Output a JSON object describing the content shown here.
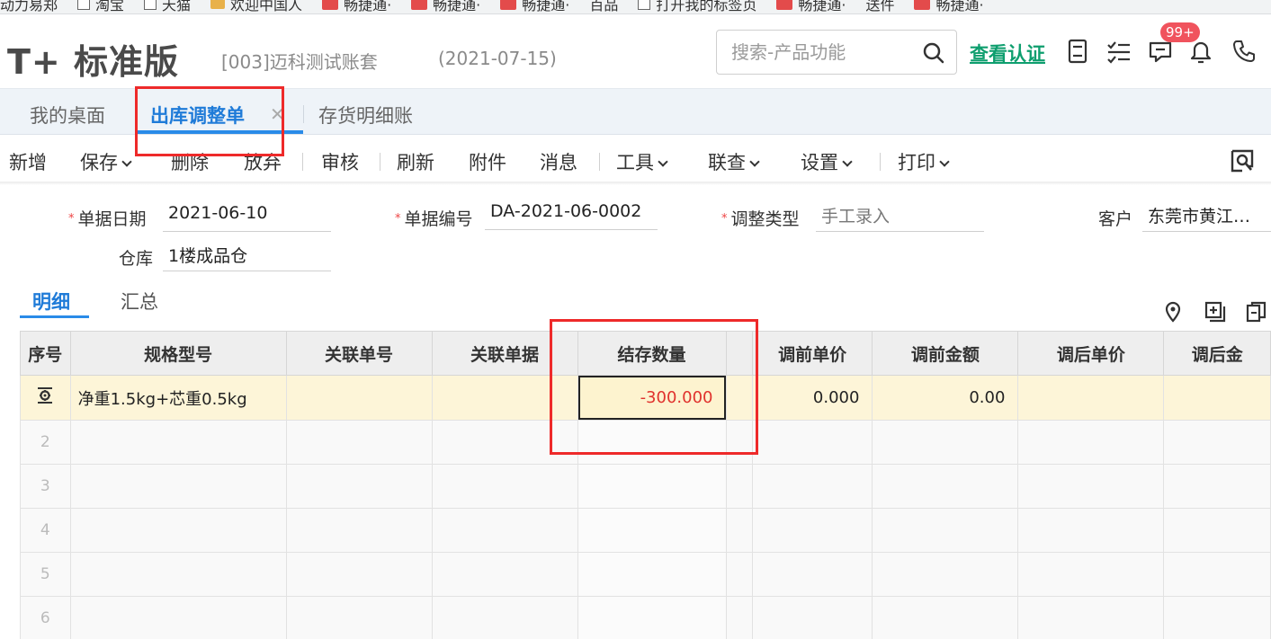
{
  "bookmarks": [
    {
      "label": "动力易郑",
      "kind": "text"
    },
    {
      "label": "淘宝",
      "kind": "square"
    },
    {
      "label": "天猫",
      "kind": "square"
    },
    {
      "label": "欢迎中国人",
      "kind": "folder"
    },
    {
      "label": "畅捷通·",
      "kind": "red"
    },
    {
      "label": "畅捷通·",
      "kind": "red"
    },
    {
      "label": "畅捷通·",
      "kind": "red"
    },
    {
      "label": "百品",
      "kind": "text"
    },
    {
      "label": "打开我的标签页",
      "kind": "square"
    },
    {
      "label": "畅捷通·",
      "kind": "red"
    },
    {
      "label": "送件",
      "kind": "text"
    },
    {
      "label": "畅捷通·",
      "kind": "red"
    }
  ],
  "header": {
    "logo": "T+ 标准版",
    "account": "[003]迈科测试账套",
    "date": "(2021-07-15)",
    "search_placeholder": "搜索-产品功能",
    "verify_link": "查看认证",
    "badge": "99+"
  },
  "tabs": [
    {
      "label": "我的桌面",
      "active": false
    },
    {
      "label": "出库调整单",
      "active": true
    },
    {
      "label": "存货明细账",
      "active": false
    }
  ],
  "toolbar": {
    "add": "新增",
    "save": "保存",
    "delete": "删除",
    "discard": "放弃",
    "audit": "审核",
    "refresh": "刷新",
    "attach": "附件",
    "message": "消息",
    "tools": "工具",
    "linked_query": "联查",
    "settings": "设置",
    "print": "打印"
  },
  "form": {
    "date_label": "单据日期",
    "date_value": "2021-06-10",
    "code_label": "单据编号",
    "code_value": "DA-2021-06-0002",
    "type_label": "调整类型",
    "type_value": "手工录入",
    "customer_label": "客户",
    "customer_value": "东莞市黄江…",
    "warehouse_label": "仓库",
    "warehouse_value": "1楼成品仓"
  },
  "subtabs": {
    "detail": "明细",
    "summary": "汇总"
  },
  "grid": {
    "columns": [
      "序号",
      "规格型号",
      "关联单号",
      "关联单据",
      "结存数量",
      "",
      "调前单价",
      "调前金额",
      "调后单价",
      "调后金"
    ],
    "row1": {
      "spec": "净重1.5kg+芯重0.5kg",
      "linked_no": "",
      "linked_doc": "",
      "stock_qty": "-300.000",
      "pre_price": "0.000",
      "pre_amount": "0.00",
      "post_price": "",
      "post_amount": ""
    },
    "empty_rows": [
      "2",
      "3",
      "4",
      "5",
      "6"
    ]
  },
  "colors": {
    "accent": "#1f7bd8",
    "verify": "#0e9e6e",
    "negative": "#e0322d",
    "annotation": "#ee2a2a",
    "selected_row": "#fdf5d8"
  }
}
